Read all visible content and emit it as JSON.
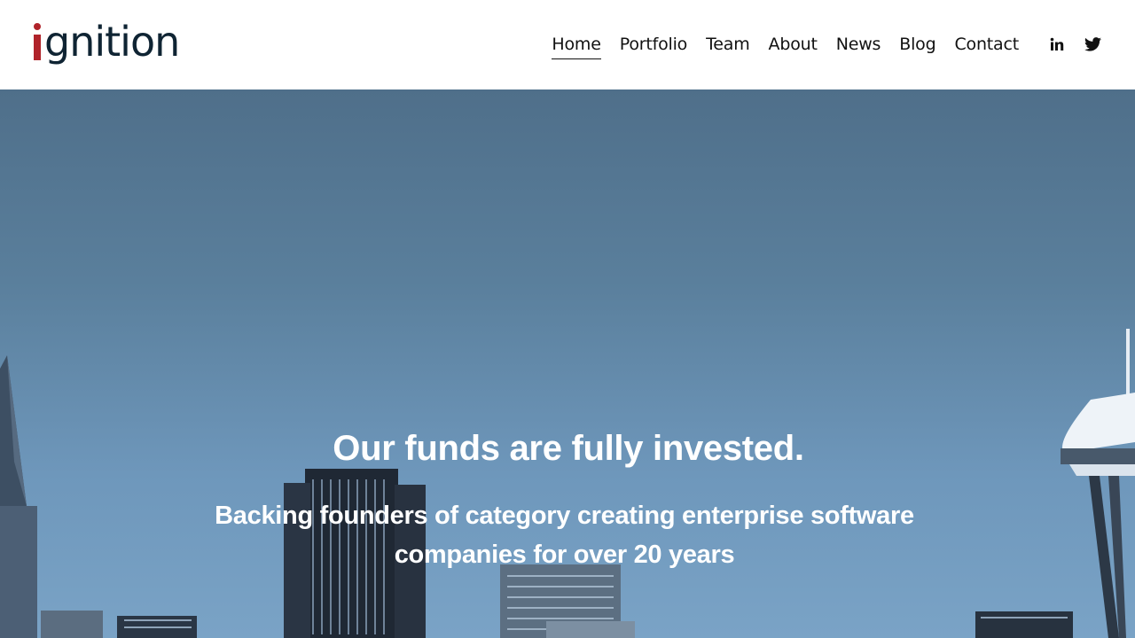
{
  "brand": {
    "logo_text": "ignition",
    "logo_rest": "gnition",
    "accent_color": "#b0232a",
    "dark_color": "#0f2433"
  },
  "nav": {
    "items": [
      {
        "label": "Home",
        "active": true
      },
      {
        "label": "Portfolio",
        "active": false
      },
      {
        "label": "Team",
        "active": false
      },
      {
        "label": "About",
        "active": false
      },
      {
        "label": "News",
        "active": false
      },
      {
        "label": "Blog",
        "active": false
      },
      {
        "label": "Contact",
        "active": false
      }
    ]
  },
  "social": {
    "icons": [
      "linkedin-icon",
      "twitter-icon"
    ]
  },
  "hero": {
    "headline": "Our funds are fully invested.",
    "subheadline": "Backing founders of category creating enterprise software companies for over 20 years",
    "text_color": "#ffffff",
    "sky_color": "#5a7f9c"
  }
}
